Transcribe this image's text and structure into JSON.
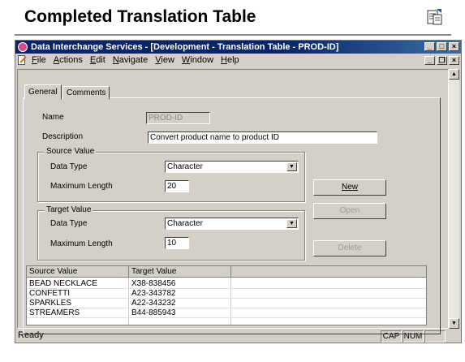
{
  "slide": {
    "title": "Completed Translation Table"
  },
  "window": {
    "title": "Data Interchange Services - [Development - Translation Table - PROD-ID]",
    "menu": [
      "File",
      "Actions",
      "Edit",
      "Navigate",
      "View",
      "Window",
      "Help"
    ]
  },
  "tabs": [
    "General",
    "Comments"
  ],
  "form": {
    "name_label": "Name",
    "name_value": "PROD-ID",
    "description_label": "Description",
    "description_value": "Convert product name to product ID",
    "source_group": "Source Value",
    "target_group": "Target Value",
    "data_type_label": "Data Type",
    "max_length_label": "Maximum Length",
    "source_data_type": "Character",
    "source_max_length": "20",
    "target_data_type": "Character",
    "target_max_length": "10"
  },
  "buttons": {
    "new": "New",
    "open": "Open",
    "delete": "Delete"
  },
  "table": {
    "columns": [
      "Source Value",
      "Target Value"
    ],
    "rows": [
      [
        "BEAD NECKLACE",
        "X38-838456"
      ],
      [
        "CONFETTI",
        "A23-343782"
      ],
      [
        "SPARKLES",
        "A22-343232"
      ],
      [
        "STREAMERS",
        "B44-885943"
      ]
    ]
  },
  "status": {
    "text": "Ready",
    "cap": "CAP",
    "num": "NUM"
  }
}
